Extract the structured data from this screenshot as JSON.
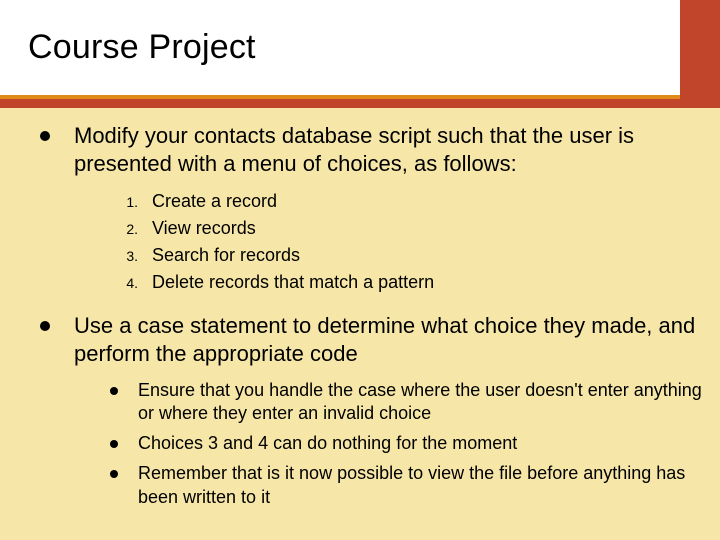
{
  "title": "Course Project",
  "bullets": {
    "b1": "Modify your contacts database script such that the user is presented with a menu of choices, as follows:",
    "numbered": [
      {
        "n": "1.",
        "t": "Create a record"
      },
      {
        "n": "2.",
        "t": "View records"
      },
      {
        "n": "3.",
        "t": "Search for records"
      },
      {
        "n": "4.",
        "t": "Delete records that match a pattern"
      }
    ],
    "b2": "Use a case statement to determine what choice they made, and perform the appropriate code",
    "sub": [
      "Ensure that you handle the case where the user doesn't  enter anything or where they enter an invalid choice",
      "Choices 3 and 4 can do nothing for the moment",
      "Remember that is it now possible to view the file before anything has been written to it"
    ]
  }
}
